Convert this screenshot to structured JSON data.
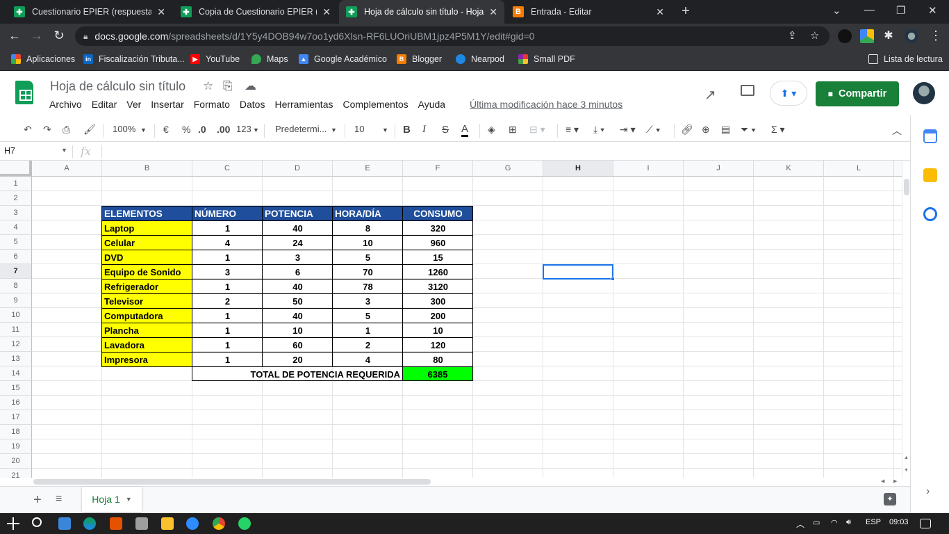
{
  "browser": {
    "tabs": [
      {
        "title": "Cuestionario EPIER (respuestas) -",
        "icon": "sheets-icon",
        "active": false
      },
      {
        "title": "Copia de Cuestionario EPIER (res",
        "icon": "sheets-icon",
        "active": false
      },
      {
        "title": "Hoja de cálculo sin título - Hojas",
        "icon": "sheets-icon",
        "active": true
      },
      {
        "title": "Entrada - Editar",
        "icon": "blogger-icon",
        "active": false
      }
    ],
    "url_host": "docs.google.com",
    "url_path": "/spreadsheets/d/1Y5y4DOB94w7oo1yd6Xlsn-RF6LUOriUBM1jpz4P5M1Y/edit#gid=0",
    "bookmarks": [
      "Aplicaciones",
      "Fiscalización Tributa...",
      "YouTube",
      "Maps",
      "Google Académico",
      "Blogger",
      "Nearpod",
      "Small PDF"
    ],
    "reading_list": "Lista de lectura"
  },
  "doc": {
    "title": "Hoja de cálculo sin título",
    "menu": [
      "Archivo",
      "Editar",
      "Ver",
      "Insertar",
      "Formato",
      "Datos",
      "Herramientas",
      "Complementos",
      "Ayuda"
    ],
    "last_modified": "Última modificación hace 3 minutos",
    "share_label": "Compartir"
  },
  "toolbar": {
    "zoom": "100%",
    "currency": "€",
    "percent": "%",
    "dec_less": ".0",
    "dec_more": ".00",
    "more_formats": "123",
    "font": "Predetermi...",
    "font_size": "10",
    "bold": "B",
    "italic": "I",
    "strike": "S",
    "text_color": "A"
  },
  "formula_bar": {
    "cell_ref": "H7",
    "fx": "fx"
  },
  "grid": {
    "columns": [
      "A",
      "B",
      "C",
      "D",
      "E",
      "F",
      "G",
      "H",
      "I",
      "J",
      "K",
      "L"
    ],
    "rows": [
      "1",
      "2",
      "3",
      "4",
      "5",
      "6",
      "7",
      "8",
      "9",
      "10",
      "11",
      "12",
      "13",
      "14",
      "15",
      "16",
      "17",
      "18",
      "19",
      "20",
      "21"
    ],
    "selected_column": "H",
    "selected_row": "7"
  },
  "table": {
    "headers": [
      "ELEMENTOS",
      "NÚMERO",
      "POTENCIA",
      "HORA/DÍA",
      "CONSUMO"
    ],
    "rows": [
      [
        "Laptop",
        "1",
        "40",
        "8",
        "320"
      ],
      [
        "Celular",
        "4",
        "24",
        "10",
        "960"
      ],
      [
        "DVD",
        "1",
        "3",
        "5",
        "15"
      ],
      [
        "Equipo de Sonido",
        "3",
        "6",
        "70",
        "1260"
      ],
      [
        "Refrigerador",
        "1",
        "40",
        "78",
        "3120"
      ],
      [
        "Televisor",
        "2",
        "50",
        "3",
        "300"
      ],
      [
        "Computadora",
        "1",
        "40",
        "5",
        "200"
      ],
      [
        "Plancha",
        "1",
        "10",
        "1",
        "10"
      ],
      [
        "Lavadora",
        "1",
        "60",
        "2",
        "120"
      ],
      [
        "Impresora",
        "1",
        "20",
        "4",
        "80"
      ]
    ],
    "total_label": "TOTAL DE POTENCIA REQUERIDA",
    "total_value": "6385",
    "colors": {
      "header_bg": "#1f4e9c",
      "name_bg": "#ffff00",
      "total_bg": "#00ff00"
    }
  },
  "sheets": {
    "active": "Hoja 1"
  },
  "taskbar": {
    "lang": "ESP",
    "time": "09:03"
  }
}
